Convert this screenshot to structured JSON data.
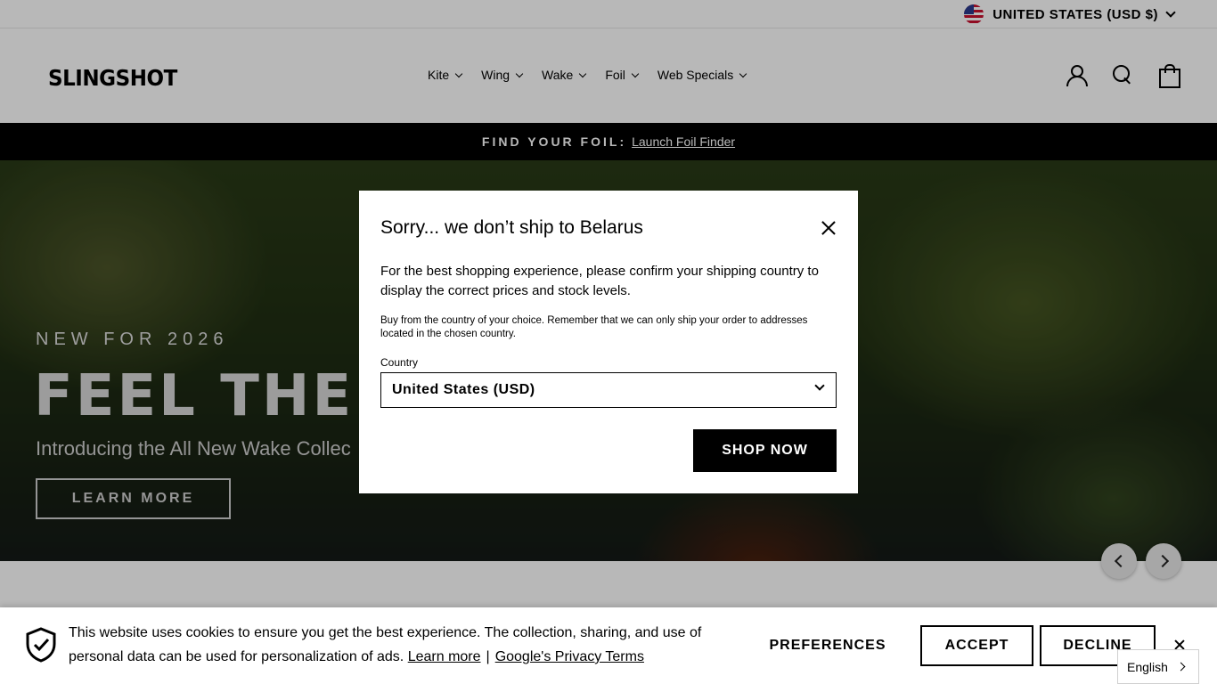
{
  "topbar": {
    "country_label": "UNITED STATES (USD $)"
  },
  "header": {
    "logo": "SLINGSHOT",
    "nav": [
      {
        "label": "Kite"
      },
      {
        "label": "Wing"
      },
      {
        "label": "Wake"
      },
      {
        "label": "Foil"
      },
      {
        "label": "Web Specials"
      }
    ]
  },
  "announcement": {
    "label": "FIND YOUR FOIL:",
    "link": "Launch Foil Finder"
  },
  "hero": {
    "eyebrow": "NEW FOR 2026",
    "title": "FEEL THE",
    "subtitle": "Introducing the All New Wake Collec",
    "button": "LEARN MORE"
  },
  "modal": {
    "title": "Sorry... we don’t ship to Belarus",
    "lead": "For the best shopping experience, please confirm your shipping country to display the correct prices and stock levels.",
    "note": "Buy from the country of your choice. Remember that we can only ship your order to addresses located in the chosen country.",
    "field_label": "Country",
    "selected_country": "United States (USD)",
    "button": "SHOP NOW"
  },
  "cookie": {
    "text": "This website uses cookies to ensure you get the best experience. The collection, sharing, and use of personal data can be used for personalization of ads.",
    "learn_more": "Learn more",
    "separator": "|",
    "privacy": "Google's Privacy Terms",
    "preferences": "PREFERENCES",
    "accept": "ACCEPT",
    "decline": "DECLINE"
  },
  "language": {
    "selected": "English"
  },
  "colors": {
    "brand": "#000000",
    "background": "#ffffff"
  }
}
